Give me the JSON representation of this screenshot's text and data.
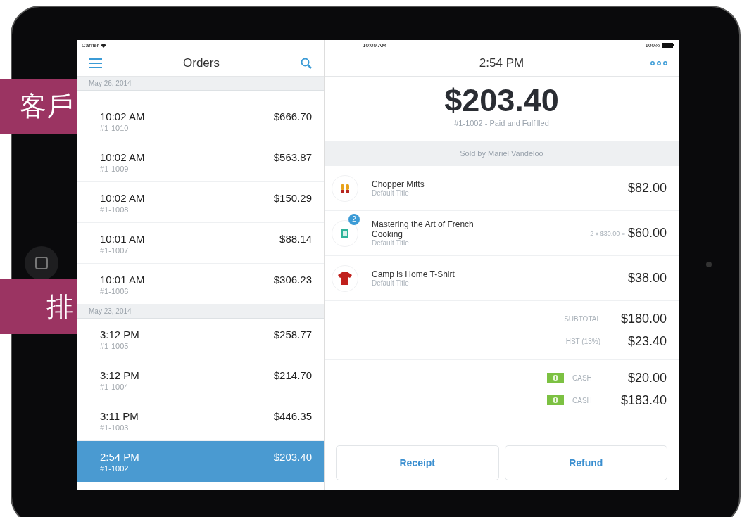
{
  "callouts": [
    {
      "text": "客戶"
    },
    {
      "text": "排"
    }
  ],
  "status_bar": {
    "carrier": "Carrier",
    "time": "10:09 AM",
    "battery": "100%"
  },
  "orders_pane": {
    "title": "Orders",
    "groups": [
      {
        "date": "May 26, 2014",
        "orders": [
          {
            "time": "10:02 AM",
            "number": "#1-1010",
            "amount": "$666.70",
            "selected": false
          },
          {
            "time": "10:02 AM",
            "number": "#1-1009",
            "amount": "$563.87",
            "selected": false
          },
          {
            "time": "10:02 AM",
            "number": "#1-1008",
            "amount": "$150.29",
            "selected": false
          },
          {
            "time": "10:01 AM",
            "number": "#1-1007",
            "amount": "$88.14",
            "selected": false
          },
          {
            "time": "10:01 AM",
            "number": "#1-1006",
            "amount": "$306.23",
            "selected": false
          }
        ]
      },
      {
        "date": "May 23, 2014",
        "orders": [
          {
            "time": "3:12 PM",
            "number": "#1-1005",
            "amount": "$258.77",
            "selected": false
          },
          {
            "time": "3:12 PM",
            "number": "#1-1004",
            "amount": "$214.70",
            "selected": false
          },
          {
            "time": "3:11 PM",
            "number": "#1-1003",
            "amount": "$446.35",
            "selected": false
          },
          {
            "time": "2:54 PM",
            "number": "#1-1002",
            "amount": "$203.40",
            "selected": true
          }
        ]
      }
    ]
  },
  "detail_pane": {
    "title": "2:54 PM",
    "total": "$203.40",
    "status": "#1-1002 - Paid and Fulfilled",
    "sold_by": "Sold by Mariel Vandeloo",
    "items": [
      {
        "kind": "mitts",
        "name": "Chopper Mitts",
        "variant": "Default Title",
        "price": "$82.00"
      },
      {
        "kind": "book",
        "name": "Mastering the Art of French Cooking",
        "variant": "Default Title",
        "quantity": "2",
        "unit_note": "2 x $30.00 =",
        "price": "$60.00"
      },
      {
        "kind": "shirt",
        "name": "Camp is Home T-Shirt",
        "variant": "Default Title",
        "price": "$38.00"
      }
    ],
    "totals": [
      {
        "label": "SUBTOTAL",
        "amount": "$180.00"
      },
      {
        "label": "HST (13%)",
        "amount": "$23.40"
      }
    ],
    "payments": [
      {
        "method": "CASH",
        "amount": "$20.00"
      },
      {
        "method": "CASH",
        "amount": "$183.40"
      }
    ],
    "buttons": [
      "Receipt",
      "Refund"
    ]
  }
}
